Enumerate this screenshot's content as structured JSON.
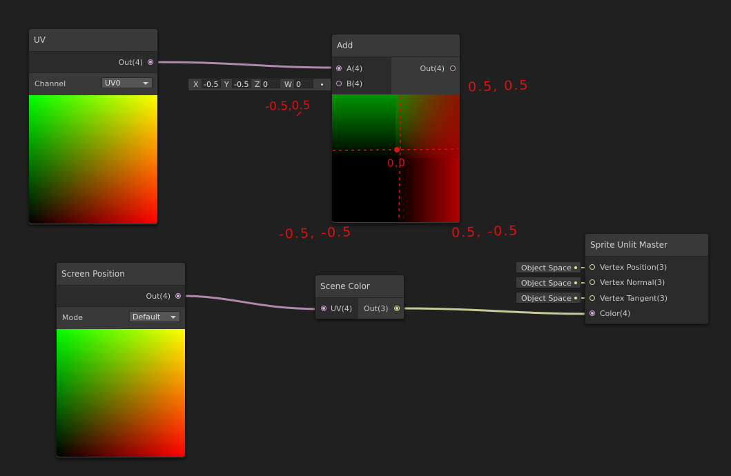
{
  "uv_node": {
    "title": "UV",
    "out_label": "Out(4)",
    "channel_label": "Channel",
    "channel_value": "UV0"
  },
  "add_node": {
    "title": "Add",
    "in_a": "A(4)",
    "in_b": "B(4)",
    "out_label": "Out(4)",
    "b_vector": {
      "x_label": "X",
      "x": "-0.5",
      "y_label": "Y",
      "y": "-0.5",
      "z_label": "Z",
      "z": "0",
      "w_label": "W",
      "w": "0"
    }
  },
  "screen_pos_node": {
    "title": "Screen Position",
    "out_label": "Out(4)",
    "mode_label": "Mode",
    "mode_value": "Default"
  },
  "scene_color_node": {
    "title": "Scene Color",
    "in_uv": "UV(4)",
    "out_label": "Out(3)"
  },
  "master_node": {
    "title": "Sprite Unlit Master",
    "inputs": [
      {
        "space": "Object Space",
        "label": "Vertex Position(3)"
      },
      {
        "space": "Object Space",
        "label": "Vertex Normal(3)"
      },
      {
        "space": "Object Space",
        "label": "Vertex Tangent(3)"
      },
      {
        "space": "",
        "label": "Color(4)"
      }
    ]
  },
  "annotations": {
    "top_right": "0.5, 0.5",
    "top_left": "-0.5,0.5",
    "center": "0,0",
    "bottom_left": "-0.5, -0.5",
    "bottom_right": "0.5, -0.5"
  },
  "colors": {
    "canvas_bg": "#202020",
    "node_bg": "#393939",
    "edge_vec4": "#b08aac",
    "edge_vec3": "#c8c898",
    "annotation_red": "#e01010"
  }
}
